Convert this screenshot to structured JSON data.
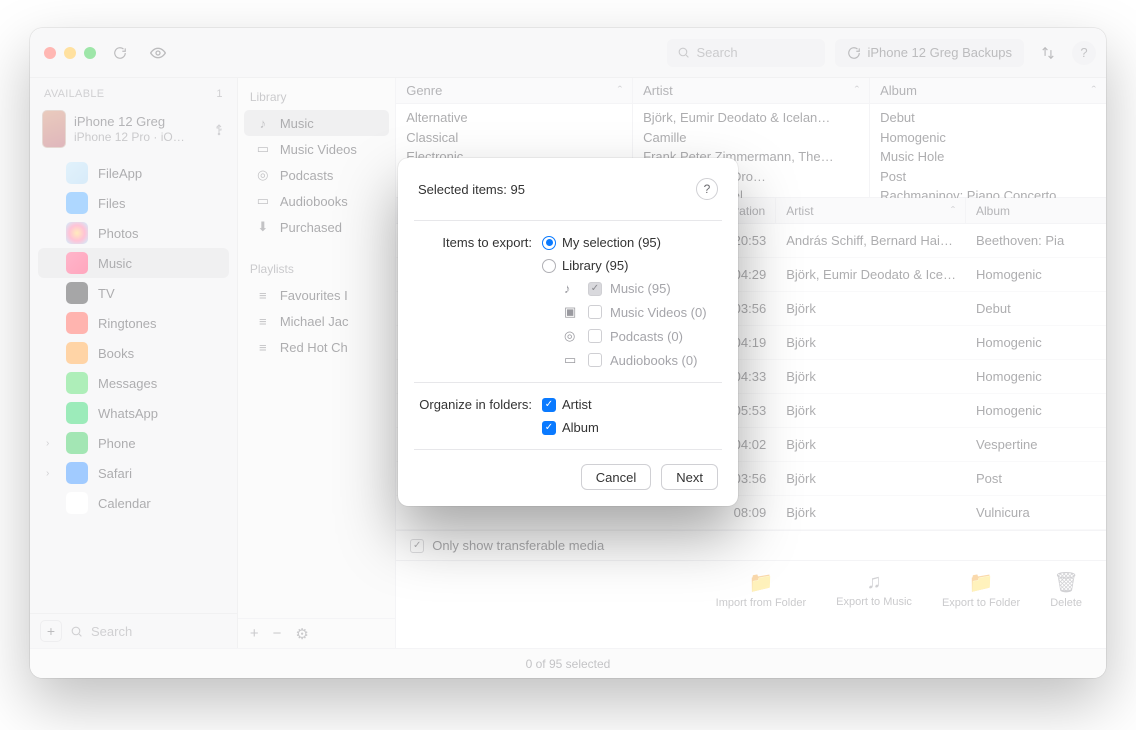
{
  "titlebar": {
    "search_placeholder": "Search",
    "backups_label": "iPhone 12 Greg Backups"
  },
  "sidebar": {
    "header": "AVAILABLE",
    "header_count": "1",
    "device": {
      "name": "iPhone 12 Greg",
      "model": "iPhone 12 Pro · iO…"
    },
    "items": [
      {
        "label": "FileApp",
        "color": "linear-gradient(135deg,#bde1f7,#a8d3f1)"
      },
      {
        "label": "Files",
        "color": "#4da7ff"
      },
      {
        "label": "Photos",
        "color": "radial-gradient(#ffd36b,#ff7aa6,#8fe1ff)"
      },
      {
        "label": "Music",
        "color": "linear-gradient(135deg,#ff5c8a,#ff3b6e)",
        "selected": true
      },
      {
        "label": "TV",
        "color": "#3a3a3c"
      },
      {
        "label": "Ringtones",
        "color": "#ff5a4f"
      },
      {
        "label": "Books",
        "color": "#ff9f3b"
      },
      {
        "label": "Messages",
        "color": "#4cd964"
      },
      {
        "label": "WhatsApp",
        "color": "#25d366"
      },
      {
        "label": "Phone",
        "color": "#34c759",
        "chevron": true
      },
      {
        "label": "Safari",
        "color": "#2f8dff",
        "chevron": true
      },
      {
        "label": "Calendar",
        "color": "#ffffff"
      }
    ],
    "bottom_search": "Search"
  },
  "library": {
    "h1": "Library",
    "items": [
      "Music",
      "Music Videos",
      "Podcasts",
      "Audiobooks",
      "Purchased"
    ],
    "selected_index": 0,
    "h2": "Playlists",
    "playlists": [
      "Favourites I",
      "Michael Jac",
      "Red Hot Ch"
    ]
  },
  "browser": {
    "cols": [
      {
        "name": "Genre",
        "rows": [
          "Alternative",
          "Classical",
          "Electronic"
        ]
      },
      {
        "name": "Artist",
        "rows": [
          "Björk, Eumir Deodato & Icelan…",
          "Camille",
          "Frank Peter Zimmermann, The…",
          "…isigwa, Mark Dro…",
          "…stavo Dudamel…"
        ]
      },
      {
        "name": "Album",
        "rows": [
          "Debut",
          "Homogenic",
          "Music Hole",
          "Post",
          "Rachmaninov: Piano Concerto…"
        ]
      }
    ]
  },
  "table": {
    "headers": {
      "duration": "Duration",
      "artist": "Artist",
      "album": "Album"
    },
    "rows": [
      {
        "dur": "20:53",
        "artist": "András Schiff, Bernard Hai…",
        "album": "Beethoven: Pia"
      },
      {
        "dur": "04:29",
        "artist": "Björk, Eumir Deodato & Ice…",
        "album": "Homogenic"
      },
      {
        "dur": "03:56",
        "artist": "Björk",
        "album": "Debut"
      },
      {
        "dur": "04:19",
        "artist": "Björk",
        "album": "Homogenic"
      },
      {
        "dur": "04:33",
        "artist": "Björk",
        "album": "Homogenic"
      },
      {
        "dur": "05:53",
        "artist": "Björk",
        "album": "Homogenic"
      },
      {
        "dur": "04:02",
        "artist": "Björk",
        "album": "Vespertine"
      },
      {
        "dur": "03:56",
        "artist": "Björk",
        "album": "Post"
      },
      {
        "dur": "08:09",
        "artist": "Björk",
        "album": "Vulnicura"
      }
    ],
    "only_transferable": "Only show transferable media"
  },
  "actions": {
    "import": "Import from Folder",
    "export_music": "Export to Music",
    "export_folder": "Export to Folder",
    "delete": "Delete"
  },
  "status": "0 of 95 selected",
  "modal": {
    "title": "Selected items: 95",
    "items_label": "Items to export:",
    "radio_selection": "My selection (95)",
    "radio_library": "Library (95)",
    "sub_music": "Music (95)",
    "sub_musicvideos": "Music Videos (0)",
    "sub_podcasts": "Podcasts (0)",
    "sub_audiobooks": "Audiobooks (0)",
    "organize_label": "Organize in folders:",
    "chk_artist": "Artist",
    "chk_album": "Album",
    "cancel": "Cancel",
    "next": "Next"
  }
}
